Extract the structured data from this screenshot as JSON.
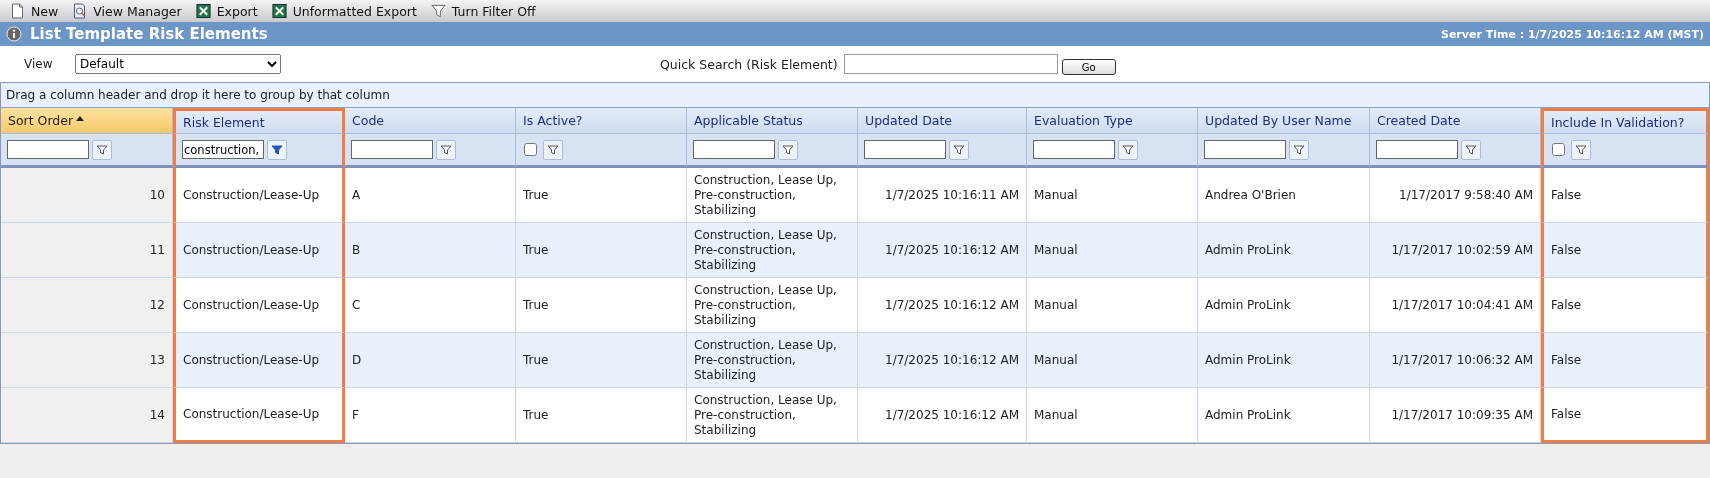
{
  "toolbar": [
    {
      "label": "New",
      "kind": "new"
    },
    {
      "label": "View Manager",
      "kind": "view"
    },
    {
      "label": "Export",
      "kind": "export"
    },
    {
      "label": "Unformatted Export",
      "kind": "export"
    },
    {
      "label": "Turn Filter Off",
      "kind": "filter"
    }
  ],
  "title": "List Template Risk Elements",
  "server_time": "Server Time : 1/7/2025 10:16:12 AM (MST)",
  "view": {
    "label": "View",
    "value": "Default"
  },
  "quick_search": {
    "label": "Quick Search (Risk Element)",
    "button": "Go"
  },
  "group_hint": "Drag a column header and drop it here to group by that column",
  "columns": [
    {
      "header": "Sort Order",
      "kind": "number",
      "sorted": true,
      "highlighted": false,
      "filter": {
        "kind": "text",
        "active": false
      }
    },
    {
      "header": "Risk Element",
      "kind": "text",
      "sorted": false,
      "highlighted": true,
      "filter": {
        "kind": "text",
        "value": "construction,",
        "active": true
      }
    },
    {
      "header": "Code",
      "kind": "text",
      "sorted": false,
      "highlighted": false,
      "filter": {
        "kind": "text",
        "active": false
      }
    },
    {
      "header": "Is Active?",
      "kind": "text",
      "sorted": false,
      "highlighted": false,
      "filter": {
        "kind": "checkbox",
        "checked": false,
        "active": false
      }
    },
    {
      "header": "Applicable Status",
      "kind": "text",
      "sorted": false,
      "highlighted": false,
      "filter": {
        "kind": "text",
        "active": false
      }
    },
    {
      "header": "Updated Date",
      "kind": "number",
      "sorted": false,
      "highlighted": false,
      "filter": {
        "kind": "text",
        "active": false
      }
    },
    {
      "header": "Evaluation Type",
      "kind": "text",
      "sorted": false,
      "highlighted": false,
      "filter": {
        "kind": "text",
        "active": false
      }
    },
    {
      "header": "Updated By User Name",
      "kind": "text",
      "sorted": false,
      "highlighted": false,
      "filter": {
        "kind": "text",
        "active": false
      }
    },
    {
      "header": "Created Date",
      "kind": "number",
      "sorted": false,
      "highlighted": false,
      "filter": {
        "kind": "text",
        "active": false
      }
    },
    {
      "header": "Include In Validation?",
      "kind": "text",
      "sorted": false,
      "highlighted": true,
      "filter": {
        "kind": "checkbox",
        "checked": false,
        "active": false
      }
    }
  ],
  "rows": [
    [
      "10",
      "Construction/Lease-Up",
      "A",
      "True",
      "Construction, Lease Up, Pre-construction, Stabilizing",
      "1/7/2025 10:16:11 AM",
      "Manual",
      "Andrea O'Brien",
      "1/17/2017 9:58:40 AM",
      "False"
    ],
    [
      "11",
      "Construction/Lease-Up",
      "B",
      "True",
      "Construction, Lease Up, Pre-construction, Stabilizing",
      "1/7/2025 10:16:12 AM",
      "Manual",
      "Admin ProLink",
      "1/17/2017 10:02:59 AM",
      "False"
    ],
    [
      "12",
      "Construction/Lease-Up",
      "C",
      "True",
      "Construction, Lease Up, Pre-construction, Stabilizing",
      "1/7/2025 10:16:12 AM",
      "Manual",
      "Admin ProLink",
      "1/17/2017 10:04:41 AM",
      "False"
    ],
    [
      "13",
      "Construction/Lease-Up",
      "D",
      "True",
      "Construction, Lease Up, Pre-construction, Stabilizing",
      "1/7/2025 10:16:12 AM",
      "Manual",
      "Admin ProLink",
      "1/17/2017 10:06:32 AM",
      "False"
    ],
    [
      "14",
      "Construction/Lease-Up",
      "F",
      "True",
      "Construction, Lease Up, Pre-construction, Stabilizing",
      "1/7/2025 10:16:12 AM",
      "Manual",
      "Admin ProLink",
      "1/17/2017 10:09:35 AM",
      "False"
    ]
  ]
}
